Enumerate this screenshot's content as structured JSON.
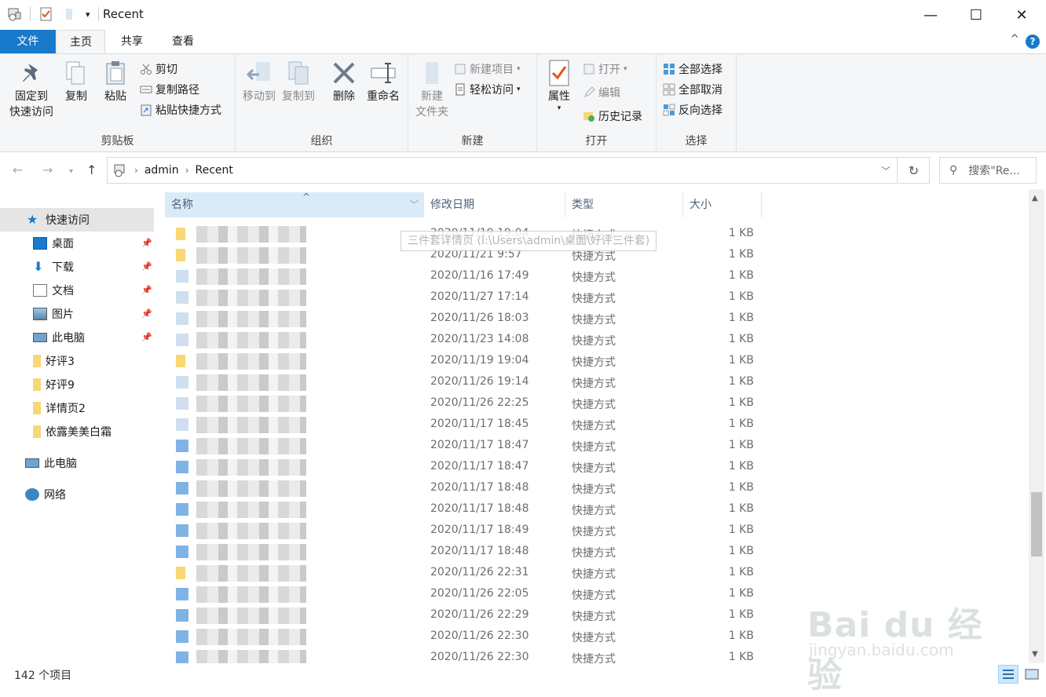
{
  "window": {
    "title": "Recent",
    "minimize": "—",
    "maximize": "☐",
    "close": "✕"
  },
  "tabs": {
    "file": "文件",
    "home": "主页",
    "share": "共享",
    "view": "查看",
    "help": "?",
    "collapse": "^"
  },
  "ribbon": {
    "clipboard": {
      "label": "剪贴板",
      "pin_line1": "固定到",
      "pin_line2": "快速访问",
      "copy": "复制",
      "paste": "粘贴",
      "cut": "剪切",
      "copy_path": "复制路径",
      "paste_shortcut": "粘贴快捷方式"
    },
    "organize": {
      "label": "组织",
      "move_to": "移动到",
      "copy_to": "复制到",
      "delete": "删除",
      "rename": "重命名"
    },
    "new": {
      "label": "新建",
      "new_folder_line1": "新建",
      "new_folder_line2": "文件夹",
      "new_item": "新建项目",
      "easy_access": "轻松访问"
    },
    "open": {
      "label": "打开",
      "properties": "属性",
      "open": "打开",
      "edit": "编辑",
      "history": "历史记录"
    },
    "select": {
      "label": "选择",
      "select_all": "全部选择",
      "select_none": "全部取消",
      "invert": "反向选择"
    }
  },
  "address": {
    "crumbs": [
      "admin",
      "Recent"
    ],
    "search_placeholder": "搜索\"Re..."
  },
  "nav": {
    "quick_access": "快速访问",
    "items": [
      {
        "label": "桌面",
        "pinned": true
      },
      {
        "label": "下载",
        "pinned": true
      },
      {
        "label": "文档",
        "pinned": true
      },
      {
        "label": "图片",
        "pinned": true
      },
      {
        "label": "此电脑",
        "pinned": true
      },
      {
        "label": "好评3",
        "pinned": false
      },
      {
        "label": "好评9",
        "pinned": false
      },
      {
        "label": "详情页2",
        "pinned": false
      },
      {
        "label": "依露美美白霜",
        "pinned": false
      }
    ],
    "this_pc": "此电脑",
    "network": "网络"
  },
  "columns": {
    "name": "名称",
    "date": "修改日期",
    "type": "类型",
    "size": "大小"
  },
  "tooltip": "三件套详情页 (I:\\Users\\admin\\桌面\\好评三件套)",
  "rows": [
    {
      "date": "2020/11/19 19:04",
      "type": "快捷方式",
      "size": "1 KB",
      "icon": "folder"
    },
    {
      "date": "2020/11/21 9:57",
      "type": "快捷方式",
      "size": "1 KB",
      "icon": "folder"
    },
    {
      "date": "2020/11/16 17:49",
      "type": "快捷方式",
      "size": "1 KB",
      "icon": "doc"
    },
    {
      "date": "2020/11/27 17:14",
      "type": "快捷方式",
      "size": "1 KB",
      "icon": "doc"
    },
    {
      "date": "2020/11/26 18:03",
      "type": "快捷方式",
      "size": "1 KB",
      "icon": "doc"
    },
    {
      "date": "2020/11/23 14:08",
      "type": "快捷方式",
      "size": "1 KB",
      "icon": "doc"
    },
    {
      "date": "2020/11/19 19:04",
      "type": "快捷方式",
      "size": "1 KB",
      "icon": "folder"
    },
    {
      "date": "2020/11/26 19:14",
      "type": "快捷方式",
      "size": "1 KB",
      "icon": "doc"
    },
    {
      "date": "2020/11/26 22:25",
      "type": "快捷方式",
      "size": "1 KB",
      "icon": "doc"
    },
    {
      "date": "2020/11/17 18:45",
      "type": "快捷方式",
      "size": "1 KB",
      "icon": "doc"
    },
    {
      "date": "2020/11/17 18:47",
      "type": "快捷方式",
      "size": "1 KB",
      "icon": "image"
    },
    {
      "date": "2020/11/17 18:47",
      "type": "快捷方式",
      "size": "1 KB",
      "icon": "image"
    },
    {
      "date": "2020/11/17 18:48",
      "type": "快捷方式",
      "size": "1 KB",
      "icon": "image"
    },
    {
      "date": "2020/11/17 18:48",
      "type": "快捷方式",
      "size": "1 KB",
      "icon": "image"
    },
    {
      "date": "2020/11/17 18:49",
      "type": "快捷方式",
      "size": "1 KB",
      "icon": "image"
    },
    {
      "date": "2020/11/17 18:48",
      "type": "快捷方式",
      "size": "1 KB",
      "icon": "image"
    },
    {
      "date": "2020/11/26 22:31",
      "type": "快捷方式",
      "size": "1 KB",
      "icon": "folder"
    },
    {
      "date": "2020/11/26 22:05",
      "type": "快捷方式",
      "size": "1 KB",
      "icon": "image"
    },
    {
      "date": "2020/11/26 22:29",
      "type": "快捷方式",
      "size": "1 KB",
      "icon": "image"
    },
    {
      "date": "2020/11/26 22:30",
      "type": "快捷方式",
      "size": "1 KB",
      "icon": "image"
    },
    {
      "date": "2020/11/26 22:30",
      "type": "快捷方式",
      "size": "1 KB",
      "icon": "image"
    }
  ],
  "status": {
    "count": "142 个项目"
  },
  "watermark": {
    "brand": "Bai du 经验",
    "url": "jingyan.baidu.com"
  },
  "colors": {
    "accent": "#1979ca",
    "selected": "#cce8ff",
    "folder": "#f8d775"
  }
}
